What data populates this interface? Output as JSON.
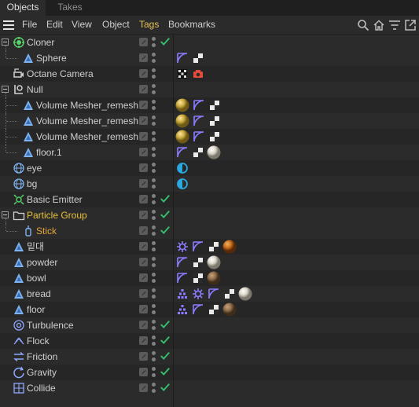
{
  "tabs": [
    {
      "label": "Objects",
      "active": true
    },
    {
      "label": "Takes",
      "active": false
    }
  ],
  "menu": {
    "file": "File",
    "edit": "Edit",
    "view": "View",
    "object": "Object",
    "tags": "Tags",
    "bookmarks": "Bookmarks"
  },
  "toolbar_icons": [
    "hamburger-menu-icon",
    "search-icon",
    "home-icon",
    "filter-icon",
    "open-window-icon"
  ],
  "colors": {
    "tags_menu": "#e4c25a",
    "particle_group": "#e9c13a",
    "stick": "#e6a33a",
    "check": "#35c16a",
    "camera_tag": "#e44b3a",
    "display_tag": "#2aa9e0",
    "phong_tag": "#8b7cff"
  },
  "objects": [
    {
      "name": "Cloner",
      "icon": "cloner-icon",
      "check": true,
      "tags": []
    },
    {
      "name": "Sphere",
      "icon": "polygon-object-icon",
      "check": false,
      "tags": [
        "phong-tag-icon",
        "uvw-tag-icon"
      ]
    },
    {
      "name": "Octane Camera",
      "icon": "camera-icon",
      "check": false,
      "tags": [
        "octane-camera-tag-icon",
        "octane-render-tag-icon"
      ]
    },
    {
      "name": "Null",
      "icon": "null-object-icon",
      "check": false,
      "tags": []
    },
    {
      "name": "Volume Mesher_remesh",
      "icon": "polygon-object-icon",
      "check": false,
      "tags": [
        "material-yellow-icon",
        "phong-tag-icon",
        "uvw-tag-icon"
      ]
    },
    {
      "name": "Volume Mesher_remesh",
      "icon": "polygon-object-icon",
      "check": false,
      "tags": [
        "material-yellow-icon",
        "phong-tag-icon",
        "uvw-tag-icon"
      ]
    },
    {
      "name": "Volume Mesher_remesh",
      "icon": "polygon-object-icon",
      "check": false,
      "tags": [
        "material-yellow-icon",
        "phong-tag-icon",
        "uvw-tag-icon"
      ]
    },
    {
      "name": "floor.1",
      "icon": "polygon-object-icon",
      "check": false,
      "tags": [
        "phong-tag-icon",
        "uvw-tag-icon",
        "material-white-icon"
      ]
    },
    {
      "name": "eye",
      "icon": "environment-icon",
      "check": false,
      "tags": [
        "display-tag-icon"
      ]
    },
    {
      "name": "bg",
      "icon": "environment-icon",
      "check": false,
      "tags": [
        "display-tag-icon"
      ]
    },
    {
      "name": "Basic Emitter",
      "icon": "emitter-icon",
      "check": true,
      "tags": []
    },
    {
      "name": "Particle Group",
      "icon": "folder-icon",
      "check": true,
      "tags": []
    },
    {
      "name": "Stick",
      "icon": "stick-icon",
      "check": true,
      "tags": []
    },
    {
      "name": "밑대",
      "icon": "polygon-object-icon",
      "check": false,
      "tags": [
        "gear-tag-icon",
        "phong-tag-icon",
        "uvw-tag-icon",
        "material-orange-icon"
      ]
    },
    {
      "name": "powder",
      "icon": "polygon-object-icon",
      "check": false,
      "tags": [
        "phong-tag-icon",
        "uvw-tag-icon",
        "material-white-icon"
      ]
    },
    {
      "name": "bowl",
      "icon": "polygon-object-icon",
      "check": false,
      "tags": [
        "phong-tag-icon",
        "uvw-tag-icon",
        "material-brown-icon"
      ]
    },
    {
      "name": "bread",
      "icon": "polygon-object-icon",
      "check": false,
      "tags": [
        "pyramid-tag-icon",
        "gear-tag-icon",
        "phong-tag-icon",
        "uvw-tag-icon",
        "material-white-icon"
      ]
    },
    {
      "name": "floor",
      "icon": "polygon-object-icon",
      "check": false,
      "tags": [
        "pyramid-tag-icon",
        "phong-tag-icon",
        "uvw-tag-icon",
        "material-brown-icon"
      ]
    },
    {
      "name": "Turbulence",
      "icon": "turbulence-icon",
      "check": true,
      "tags": []
    },
    {
      "name": "Flock",
      "icon": "flock-icon",
      "check": true,
      "tags": []
    },
    {
      "name": "Friction",
      "icon": "friction-icon",
      "check": true,
      "tags": []
    },
    {
      "name": "Gravity",
      "icon": "gravity-icon",
      "check": true,
      "tags": []
    },
    {
      "name": "Collide",
      "icon": "collide-icon",
      "check": true,
      "tags": []
    }
  ]
}
